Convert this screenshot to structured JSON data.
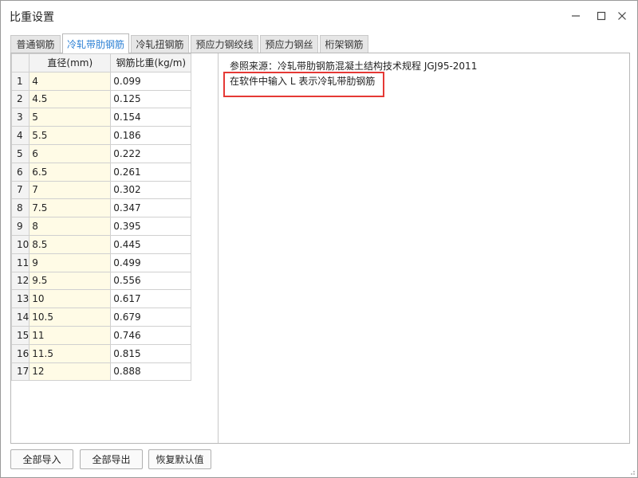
{
  "window": {
    "title": "比重设置",
    "controls": {
      "minimize": "minimize-icon",
      "maximize": "maximize-icon",
      "close": "close-icon"
    }
  },
  "tabs": [
    {
      "label": "普通钢筋",
      "active": false
    },
    {
      "label": "冷轧带肋钢筋",
      "active": true
    },
    {
      "label": "冷轧扭钢筋",
      "active": false
    },
    {
      "label": "预应力钢绞线",
      "active": false
    },
    {
      "label": "预应力钢丝",
      "active": false
    },
    {
      "label": "桁架钢筋",
      "active": false
    }
  ],
  "table": {
    "headers": [
      "",
      "直径(mm)",
      "钢筋比重(kg/m)"
    ],
    "rows": [
      {
        "n": "1",
        "d": "4",
        "w": "0.099"
      },
      {
        "n": "2",
        "d": "4.5",
        "w": "0.125"
      },
      {
        "n": "3",
        "d": "5",
        "w": "0.154"
      },
      {
        "n": "4",
        "d": "5.5",
        "w": "0.186"
      },
      {
        "n": "5",
        "d": "6",
        "w": "0.222"
      },
      {
        "n": "6",
        "d": "6.5",
        "w": "0.261"
      },
      {
        "n": "7",
        "d": "7",
        "w": "0.302"
      },
      {
        "n": "8",
        "d": "7.5",
        "w": "0.347"
      },
      {
        "n": "9",
        "d": "8",
        "w": "0.395"
      },
      {
        "n": "10",
        "d": "8.5",
        "w": "0.445"
      },
      {
        "n": "11",
        "d": "9",
        "w": "0.499"
      },
      {
        "n": "12",
        "d": "9.5",
        "w": "0.556"
      },
      {
        "n": "13",
        "d": "10",
        "w": "0.617"
      },
      {
        "n": "14",
        "d": "10.5",
        "w": "0.679"
      },
      {
        "n": "15",
        "d": "11",
        "w": "0.746"
      },
      {
        "n": "16",
        "d": "11.5",
        "w": "0.815"
      },
      {
        "n": "17",
        "d": "12",
        "w": "0.888"
      }
    ]
  },
  "notes": {
    "reference": "参照来源：冷轧带肋钢筋混凝土结构技术规程 JGJ95-2011",
    "hint": "在软件中输入 L 表示冷轧带肋钢筋"
  },
  "buttons": {
    "import_all": "全部导入",
    "export_all": "全部导出",
    "restore_default": "恢复默认值"
  },
  "colors": {
    "active_tab_text": "#2a7fd4",
    "highlight_box": "#e53935",
    "diameter_cell_bg": "#fffbe6"
  }
}
